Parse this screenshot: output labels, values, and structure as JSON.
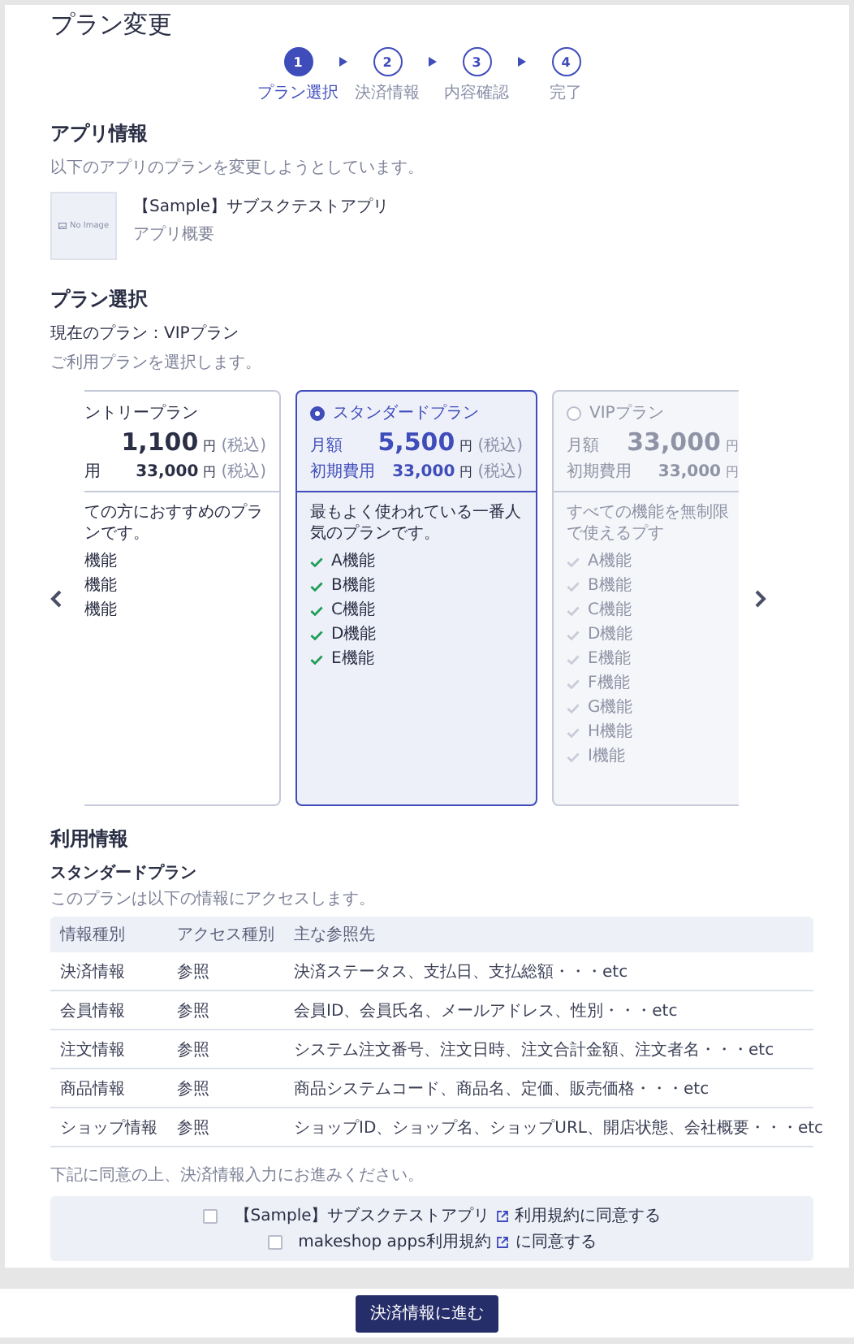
{
  "page": {
    "title": "プラン変更"
  },
  "steps": [
    {
      "number": "1",
      "label": "プラン選択",
      "active": true
    },
    {
      "number": "2",
      "label": "決済情報",
      "active": false
    },
    {
      "number": "3",
      "label": "内容確認",
      "active": false
    },
    {
      "number": "4",
      "label": "完了",
      "active": false
    }
  ],
  "app_info": {
    "heading": "アプリ情報",
    "note": "以下のアプリのプランを変更しようとしています。",
    "thumbnail_text": "No Image",
    "app_name": "【Sample】サブスクテストアプリ",
    "app_summary": "アプリ概要"
  },
  "plan_select": {
    "heading": "プラン選択",
    "current_plan": "現在のプラン：VIPプラン",
    "note": "ご利用プランを選択します。"
  },
  "plans": [
    {
      "name": "ントリープラン",
      "monthly_price": "1,100",
      "unit": "円",
      "tax": "(税込)",
      "initial_label": "用",
      "initial_price": "33,000",
      "initial_unit": "円",
      "initial_tax": "(税込)",
      "description": "ての方におすすめのプランです。",
      "features": [
        "機能",
        "機能",
        "機能"
      ],
      "selected": false,
      "disabled": false
    },
    {
      "name": "スタンダードプラン",
      "monthly_label": "月額",
      "monthly_price": "5,500",
      "unit": "円",
      "tax": "(税込)",
      "initial_label": "初期費用",
      "initial_price": "33,000",
      "initial_unit": "円",
      "initial_tax": "(税込)",
      "description": "最もよく使われている一番人気のプランです。",
      "features": [
        "A機能",
        "B機能",
        "C機能",
        "D機能",
        "E機能"
      ],
      "selected": true,
      "disabled": false
    },
    {
      "name": "VIPプラン",
      "monthly_label": "月額",
      "monthly_price": "33,000",
      "unit": "円",
      "initial_label": "初期費用",
      "initial_price": "33,000",
      "initial_unit": "円",
      "description": "すべての機能を無制限で使えるプす",
      "features": [
        "A機能",
        "B機能",
        "C機能",
        "D機能",
        "E機能",
        "F機能",
        "G機能",
        "H機能",
        "I機能"
      ],
      "selected": false,
      "disabled": true
    }
  ],
  "usage": {
    "heading": "利用情報",
    "plan_name": "スタンダードプラン",
    "note": "このプランは以下の情報にアクセスします。",
    "columns": [
      "情報種別",
      "アクセス種別",
      "主な参照先"
    ],
    "rows": [
      [
        "決済情報",
        "参照",
        "決済ステータス、支払日、支払総額・・・etc"
      ],
      [
        "会員情報",
        "参照",
        "会員ID、会員氏名、メールアドレス、性別・・・etc"
      ],
      [
        "注文情報",
        "参照",
        "システム注文番号、注文日時、注文合計金額、注文者名・・・etc"
      ],
      [
        "商品情報",
        "参照",
        "商品システムコード、商品名、定価、販売価格・・・etc"
      ],
      [
        "ショップ情報",
        "参照",
        "ショップID、ショップ名、ショップURL、開店状態、会社概要・・・etc"
      ]
    ]
  },
  "consent": {
    "note": "下記に同意の上、決済情報入力にお進みください。",
    "items": [
      {
        "link": "【Sample】サブスクテストアプリ",
        "text": "利用規約に同意する",
        "checked": false
      },
      {
        "link": "makeshop apps利用規約",
        "text": "に同意する",
        "checked": false
      }
    ]
  },
  "footer": {
    "button": "決済情報に進む"
  }
}
